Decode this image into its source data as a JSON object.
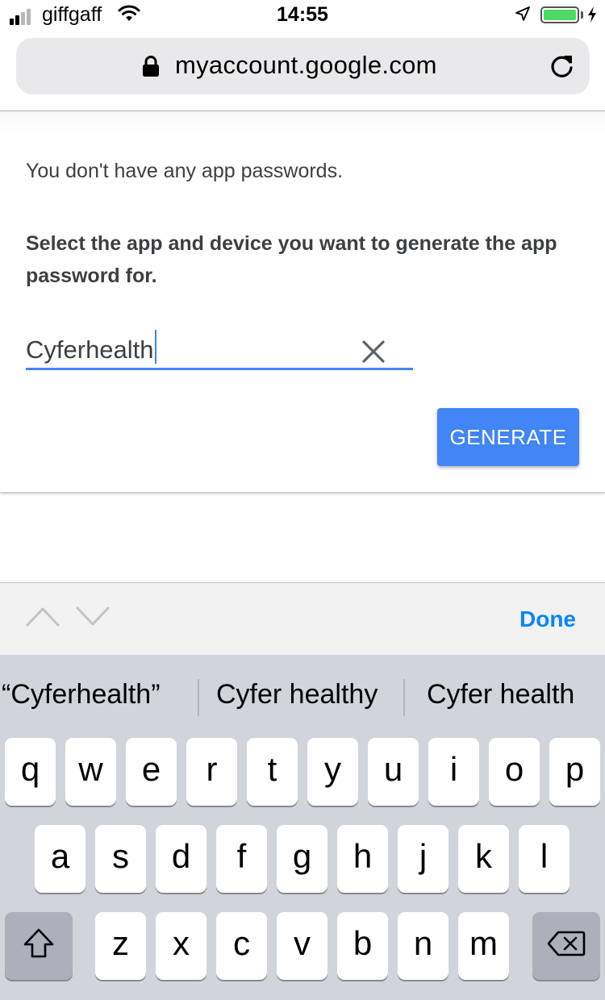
{
  "status_bar": {
    "carrier": "giffgaff",
    "time": "14:55",
    "signal_bars_filled": 2,
    "signal_bars_total": 4,
    "battery_level": 1.0,
    "icons": [
      "signal-icon",
      "wifi-icon",
      "location-arrow-icon",
      "battery-icon",
      "charging-bolt-icon"
    ]
  },
  "browser": {
    "url": "myaccount.google.com",
    "icons": [
      "lock-icon",
      "reload-icon"
    ]
  },
  "page": {
    "no_passwords_text": "You don't have any app passwords.",
    "instructions": "Select the app and device you want to generate the app password for.",
    "app_input_value": "Cyferhealth",
    "generate_label": "GENERATE",
    "accent_color": "#4285f4"
  },
  "accessory_bar": {
    "done_label": "Done",
    "icons": [
      "chevron-up-icon",
      "chevron-down-icon"
    ]
  },
  "keyboard": {
    "suggestions": [
      "“Cyferhealth”",
      "Cyfer healthy",
      "Cyfer health"
    ],
    "row1": [
      "q",
      "w",
      "e",
      "r",
      "t",
      "y",
      "u",
      "i",
      "o",
      "p"
    ],
    "row2": [
      "a",
      "s",
      "d",
      "f",
      "g",
      "h",
      "j",
      "k",
      "l"
    ],
    "row3": [
      "z",
      "x",
      "c",
      "v",
      "b",
      "n",
      "m"
    ],
    "special_keys": [
      "shift-icon",
      "backspace-icon"
    ]
  }
}
